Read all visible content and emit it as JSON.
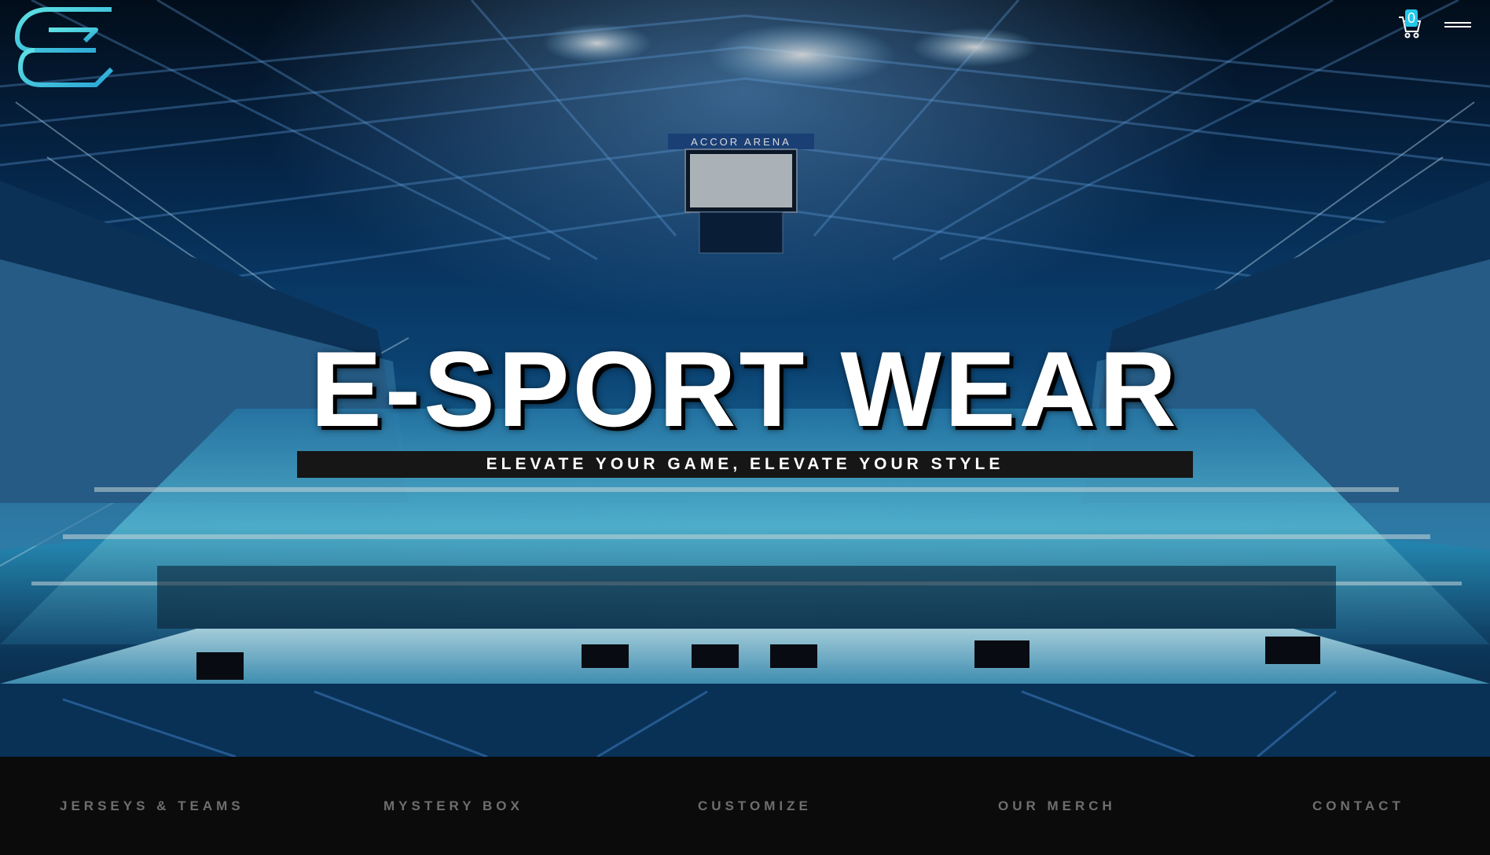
{
  "hero": {
    "title": "E-SPORT WEAR",
    "tagline": "ELEVATE YOUR GAME, ELEVATE YOUR STYLE",
    "arena_sign": "ACCOR ARENA"
  },
  "header": {
    "logo_icon": "e-logo-icon",
    "cart_icon": "cart-icon",
    "cart_count": "0",
    "menu_icon": "hamburger-menu-icon"
  },
  "nav": {
    "items": [
      {
        "label": "JERSEYS & TEAMS"
      },
      {
        "label": "MYSTERY BOX"
      },
      {
        "label": "CUSTOMIZE"
      },
      {
        "label": "OUR MERCH"
      },
      {
        "label": "CONTACT"
      }
    ]
  },
  "colors": {
    "accent": "#22c7e8",
    "nav_background": "#0b0b0c",
    "nav_text": "#6e6e6e",
    "tagline_background": "#161616"
  }
}
